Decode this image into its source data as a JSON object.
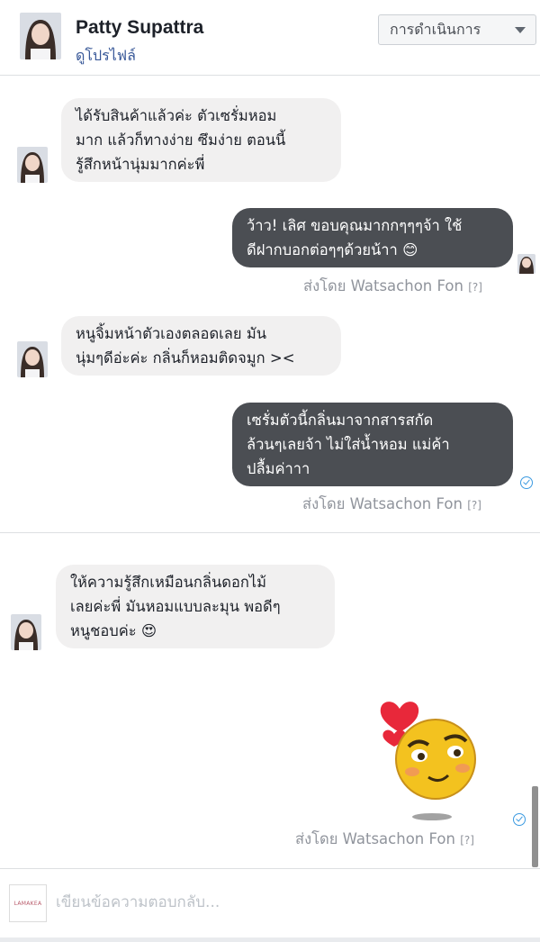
{
  "header": {
    "name": "Patty Supattra",
    "profile_link": "ดูโปรไฟล์",
    "actions_label": "การดำเนินการ"
  },
  "messages": [
    {
      "direction": "incoming",
      "text": "ได้รับสินค้าแล้วค่ะ ตัวเซรั่มหอม\nมาก แล้วก็ทางง่าย ซึมง่าย ตอนนี้\nรู้สึกหน้านุ่มมากค่ะพี่"
    },
    {
      "direction": "outgoing",
      "text": "ว้าว! เลิศ ขอบคุณมากกๆๆๆจ้า ใช้\nดีฝากบอกต่อๆๆด้วยน้าา 😊",
      "sent_by": "ส่งโดย Watsachon Fon",
      "help": "[?]"
    },
    {
      "direction": "incoming",
      "text": "หนูจิ้มหน้าตัวเองตลอดเลย มัน\nนุ่มๆดีอ่ะค่ะ กลิ่นก็หอมติดจมูก ><"
    },
    {
      "direction": "outgoing",
      "text": "เซรั่มตัวนี้กลิ่นมาจากสารสกัด\nล้วนๆเลยจ้า ไม่ใส่น้ำหอม แม่ค้า\nปลื้มค่าาา",
      "sent_by": "ส่งโดย Watsachon Fon",
      "help": "[?]"
    },
    {
      "direction": "incoming",
      "text": "ให้ความรู้สึกเหมือนกลิ่นดอกไม้\nเลยค่ะพี่ มันหอมแบบละมุน พอดีๆ\nหนูชอบค่ะ 😍"
    },
    {
      "direction": "outgoing",
      "sticker": "love-emoji-sticker",
      "sent_by": "ส่งโดย Watsachon Fon",
      "help": "[?]"
    }
  ],
  "composer": {
    "placeholder": "เขียนข้อความตอบกลับ...",
    "logo_text": "LAMAKEA"
  },
  "colors": {
    "outgoing_bubble": "#4b4e53",
    "incoming_bubble": "#f1f0f0",
    "link": "#385898",
    "seen_check": "#3b9ae1"
  }
}
